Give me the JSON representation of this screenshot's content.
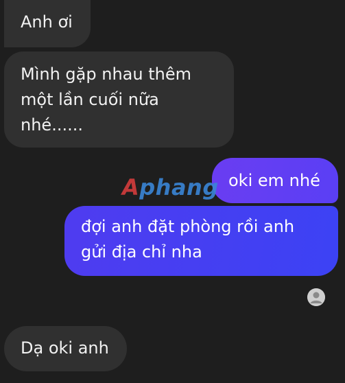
{
  "messages": [
    {
      "id": "b1",
      "direction": "incoming",
      "text": "Anh ơi"
    },
    {
      "id": "b2",
      "direction": "incoming",
      "text": "Mình gặp nhau thêm\nmột lần cuối nữa\nnhé......"
    },
    {
      "id": "b3",
      "direction": "outgoing",
      "text": "oki em nhé"
    },
    {
      "id": "b4",
      "direction": "outgoing",
      "text": "đợi anh đặt phòng rồi anh\ngửi địa chỉ nha"
    },
    {
      "id": "b5",
      "direction": "incoming",
      "text": "Dạ oki anh"
    }
  ],
  "watermark": {
    "first": "A",
    "rest": "phang"
  },
  "read_receipt": {
    "icon": "avatar-icon"
  },
  "colors": {
    "background": "#1e1e1e",
    "incoming_bubble": "#303030",
    "outgoing_bubble": "#4b3df2",
    "watermark_red": "#d43c3c",
    "watermark_blue": "#3a86d6"
  }
}
